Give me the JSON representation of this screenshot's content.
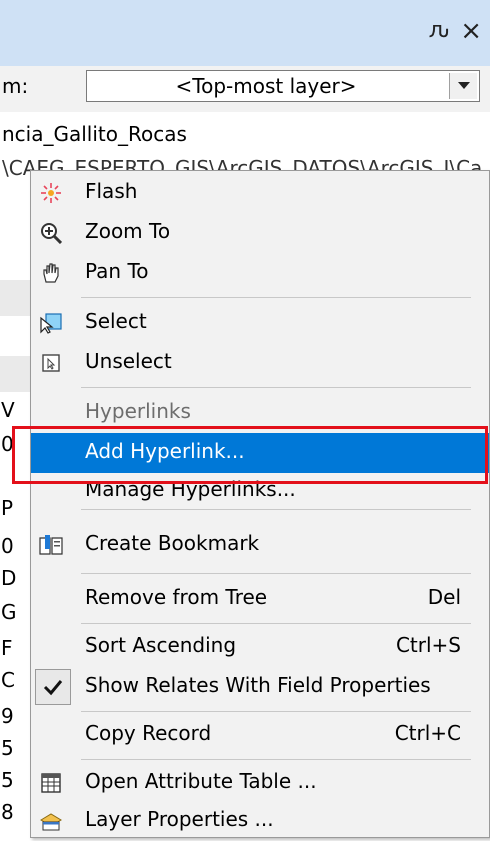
{
  "window": {
    "pin_glyph": "ԉ",
    "close_glyph": "×"
  },
  "identify": {
    "label": "m:",
    "layer_value": "<Top-most layer>"
  },
  "tree": {
    "root": "ncia_Gallito_Rocas",
    "path": "\\CAEG_ESPERTO_GIS\\ArcGIS_DATOS\\ArcGIS_I\\Ca"
  },
  "background_chars": [
    "V",
    "0",
    "P",
    "0",
    "D",
    "G",
    "F",
    "C",
    "9",
    "5",
    "5",
    "8"
  ],
  "menu": {
    "items": [
      {
        "label": "Flash",
        "icon": "flash-icon"
      },
      {
        "label": "Zoom To",
        "icon": "zoom-in-icon"
      },
      {
        "label": "Pan To",
        "icon": "pan-hand-icon"
      },
      {
        "label": "Select",
        "icon": "select-features-icon"
      },
      {
        "label": "Unselect",
        "icon": "unselect-features-icon"
      },
      {
        "label": "Hyperlinks",
        "disabled": true
      },
      {
        "label": "Add Hyperlink...",
        "highlighted": true
      },
      {
        "label": "Manage Hyperlinks..."
      },
      {
        "label": "Create Bookmark",
        "icon": "bookmark-icon"
      },
      {
        "label": "Remove from Tree",
        "shortcut": "Del"
      },
      {
        "label": "Sort Ascending",
        "shortcut": "Ctrl+S"
      },
      {
        "label": "Show Relates With Field Properties",
        "checked": true
      },
      {
        "label": "Copy Record",
        "shortcut": "Ctrl+C"
      },
      {
        "label": "Open Attribute Table ...",
        "icon": "attribute-table-icon"
      },
      {
        "label": "Layer Properties ...",
        "icon": "layer-properties-icon"
      }
    ]
  },
  "colors": {
    "highlight": "#0078d7",
    "callout": "#e3101a",
    "titlebar": "#cfe1f5"
  }
}
